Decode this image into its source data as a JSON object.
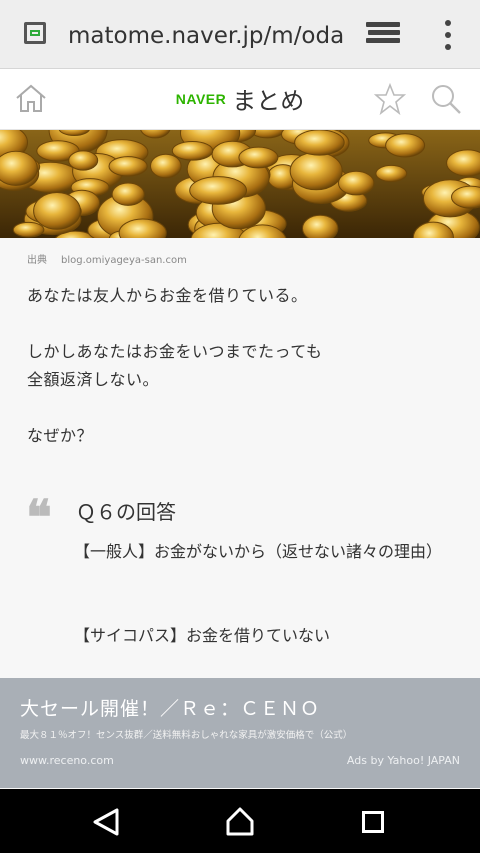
{
  "browser": {
    "url": "matome.naver.jp/m/odai/"
  },
  "header": {
    "logo_brand": "NAVER",
    "logo_name": "まとめ"
  },
  "article": {
    "source_label": "出典",
    "source_url": "blog.omiyageya-san.com",
    "paragraph1": "あなたは友人からお金を借りている。",
    "paragraph2_line1": "しかしあなたはお金をいつまでたっても",
    "paragraph2_line2": "全額返済しない。",
    "paragraph3": "なぜか？",
    "quote_mark": "❝",
    "answer_title": "Ｑ６の回答",
    "answer1": "【一般人】お金がないから（返せない諸々の理由）",
    "answer2": "【サイコパス】お金を借りていない"
  },
  "ad": {
    "title": "大セール開催！／Ｒｅ：ＣＥＮＯ",
    "description": "最大８１％オフ！センス抜群／送料無料おしゃれな家具が激安価格で（公式）",
    "url": "www.receno.com",
    "provider": "Ads by Yahoo! JAPAN"
  },
  "colors": {
    "naver_green": "#2db400",
    "ad_background": "#a9afb6"
  }
}
